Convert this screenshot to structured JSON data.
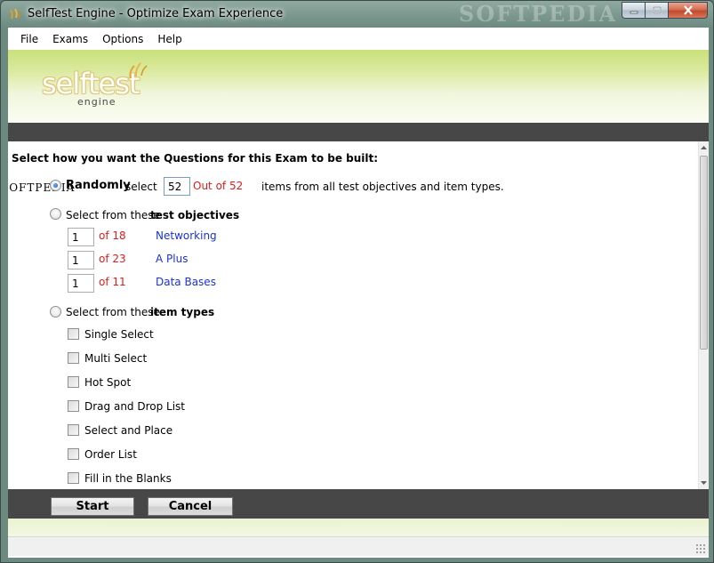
{
  "window": {
    "title": "SelfTest Engine - Optimize Exam Experience",
    "watermark": "SOFTPEDIA",
    "side_watermark": "SOFTPEDIA"
  },
  "menu": {
    "items": [
      "File",
      "Exams",
      "Options",
      "Help"
    ]
  },
  "logo": {
    "main": "selftest",
    "sub": "engine"
  },
  "form": {
    "heading": "Select how you want the Questions for this Exam to be built:",
    "randomly": {
      "label": "Randomly",
      "select_text": "select",
      "value": "52",
      "out_of": "Out of 52",
      "suffix": "items from all test objectives and item types.",
      "checked": true
    },
    "objectives": {
      "prefix": "Select from these",
      "label": "test objectives",
      "checked": false,
      "rows": [
        {
          "value": "1",
          "of": "of 18",
          "name": "Networking"
        },
        {
          "value": "1",
          "of": "of 23",
          "name": "A Plus"
        },
        {
          "value": "1",
          "of": "of 11",
          "name": "Data Bases"
        }
      ]
    },
    "item_types": {
      "prefix": "Select from these",
      "label": "item types",
      "checked": false,
      "types": [
        "Single Select",
        "Multi Select",
        "Hot Spot",
        "Drag and Drop List",
        "Select and Place",
        "Order List",
        "Fill in the Blanks"
      ]
    }
  },
  "buttons": {
    "start": "Start",
    "cancel": "Cancel"
  },
  "colors": {
    "banner_green": "#c9e07a",
    "dark_bar": "#474747",
    "count_red": "#e01b1b",
    "objective_blue": "#1a32d0"
  }
}
